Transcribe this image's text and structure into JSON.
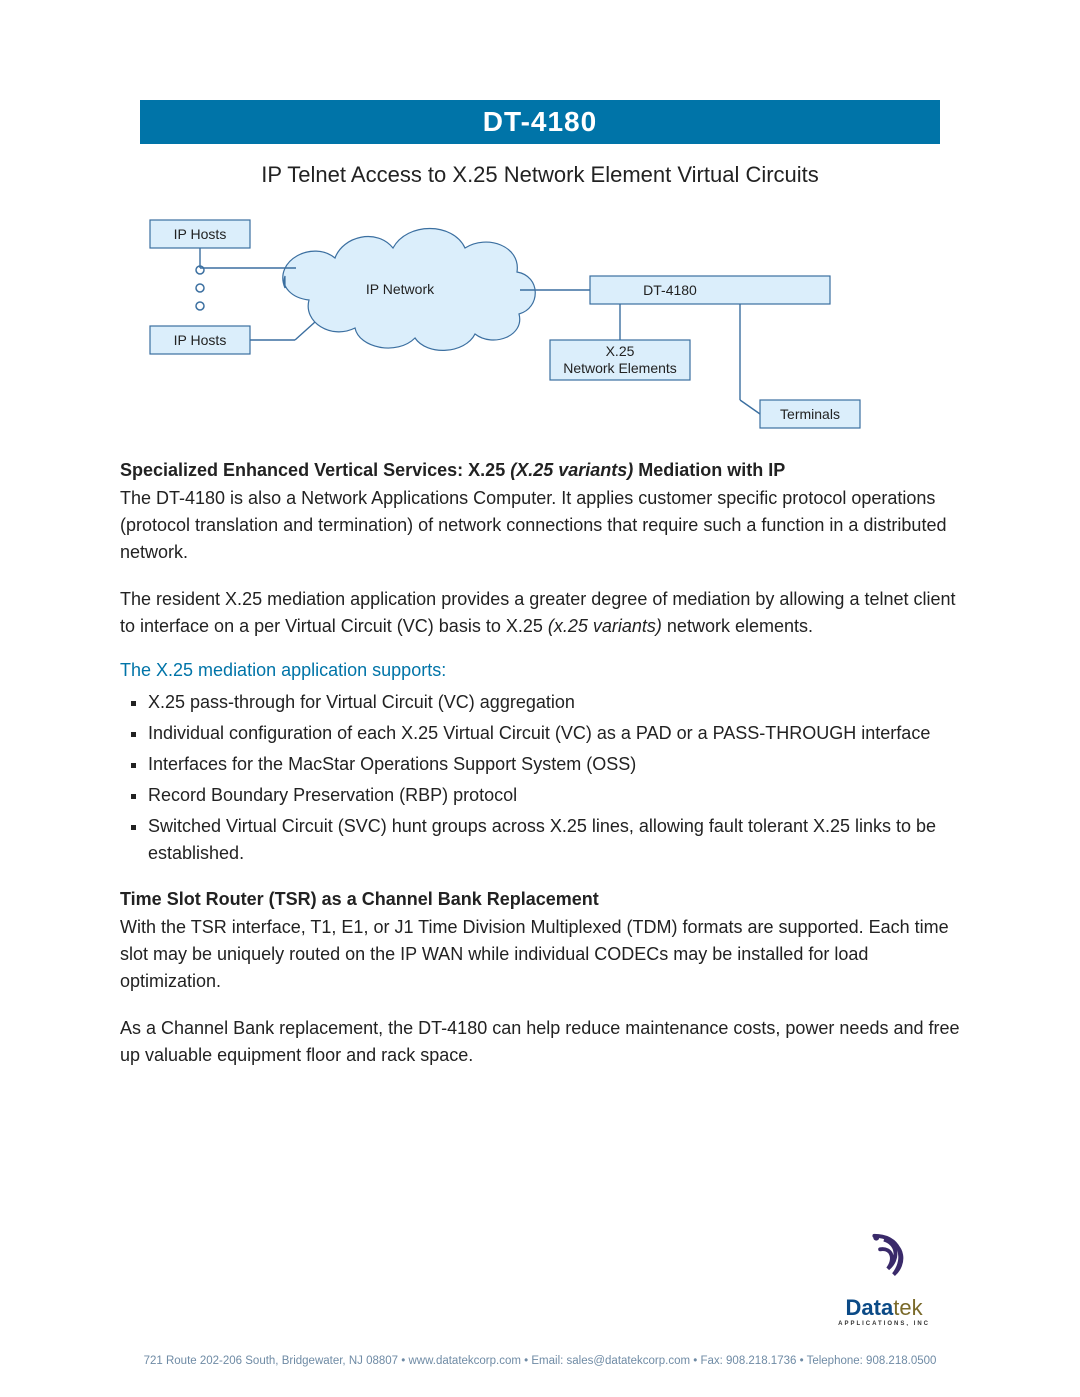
{
  "header": {
    "product": "DT-4180"
  },
  "subtitle": "IP Telnet Access to X.25 Network Element Virtual Circuits",
  "diagram": {
    "ip_hosts_top": "IP Hosts",
    "ip_hosts_bottom": "IP Hosts",
    "cloud": "IP Network",
    "dt4180": "DT-4180",
    "x25_l1": "X.25",
    "x25_l2": "Network Elements",
    "terminals": "Terminals"
  },
  "section1": {
    "heading_pre": "Specialized Enhanced Vertical Services: X.25 ",
    "heading_italic": "(X.25 variants)",
    "heading_post": " Mediation with IP",
    "para1": "The DT-4180 is also a Network Applications Computer.  It applies customer specific protocol operations (protocol translation and termination) of network connections that require such a function in a distributed network.",
    "para2_pre": "The resident X.25 mediation application provides a greater degree of mediation by allowing a telnet client to interface on a per Virtual Circuit (VC) basis to X.25 ",
    "para2_italic": "(x.25 variants)",
    "para2_post": " network elements."
  },
  "mediation": {
    "heading": "The X.25 mediation application supports:",
    "items": [
      "X.25 pass-through for Virtual Circuit (VC) aggregation",
      "Individual configuration of each X.25 Virtual Circuit (VC) as a PAD or a PASS-THROUGH interface",
      "Interfaces for the MacStar Operations Support System (OSS)",
      "Record Boundary Preservation (RBP) protocol",
      "Switched Virtual Circuit (SVC) hunt groups across X.25 lines,  allowing fault tolerant X.25 links to be established."
    ]
  },
  "section2": {
    "heading": "Time Slot Router (TSR) as a Channel Bank Replacement",
    "para1": "With the TSR interface, T1, E1, or J1 Time Division Multiplexed (TDM) formats are supported.  Each time slot may be uniquely routed on the IP WAN while individual CODECs may be installed for load optimization.",
    "para2": "As a Channel Bank replacement, the DT-4180 can help reduce maintenance costs, power needs and free up valuable equipment floor and rack space."
  },
  "logo": {
    "data": "Data",
    "tek": "tek",
    "sub": "APPLICATIONS, INC"
  },
  "footer": "721 Route 202-206 South, Bridgewater, NJ 08807 • www.datatekcorp.com • Email: sales@datatekcorp.com • Fax: 908.218.1736 • Telephone: 908.218.0500"
}
